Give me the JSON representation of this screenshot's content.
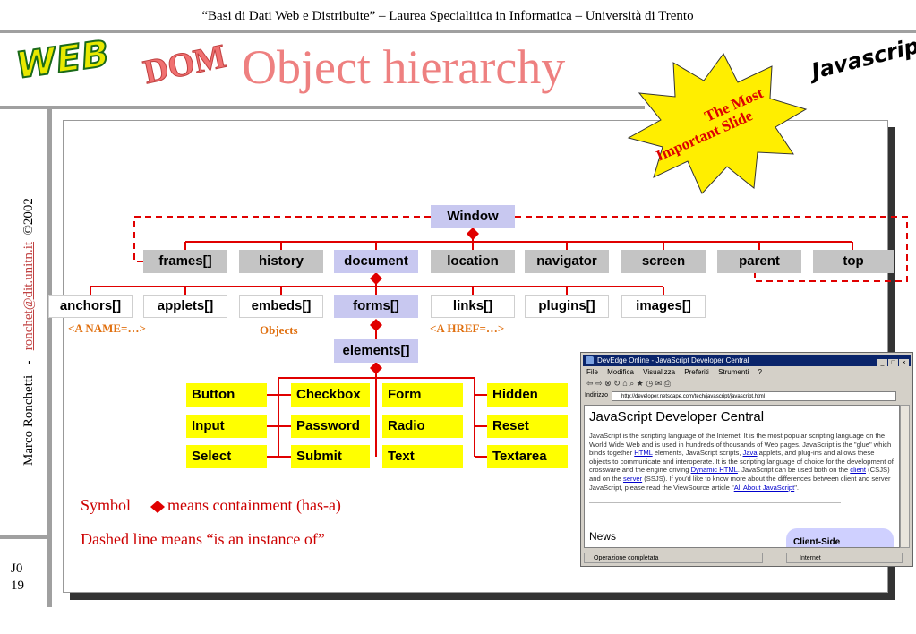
{
  "header": {
    "course_line": "“Basi di Dati Web e Distribuite” – Laurea Specialitica in Informatica – Università di Trento"
  },
  "title": {
    "web": "WEB",
    "dom": "DOM",
    "main": "Object hierarchy",
    "javascript": "Javascript",
    "starburst": [
      "The Most",
      "Important Slide"
    ]
  },
  "sidebar": {
    "author": "Marco Ronchetti",
    "separator": "-",
    "email": "ronchet@dit.unitn.it",
    "copyright": "©2002"
  },
  "slide_id": [
    "J0",
    "19"
  ],
  "hierarchy": {
    "root": "Window",
    "level1": [
      "frames[]",
      "history",
      "document",
      "location",
      "navigator",
      "screen",
      "parent",
      "top"
    ],
    "level2": [
      "anchors[]",
      "applets[]",
      "embeds[]",
      "forms[]",
      "links[]",
      "plugins[]",
      "images[]"
    ],
    "level3": "elements[]",
    "notes": [
      "<A NAME=…>",
      "Objects",
      "<A HREF=…>"
    ],
    "form_elements": [
      [
        "Button",
        "Checkbox",
        "Form",
        "Hidden"
      ],
      [
        "Input",
        "Password",
        "Radio",
        "Reset"
      ],
      [
        "Select",
        "Submit",
        "Text",
        "Textarea"
      ]
    ]
  },
  "legend": {
    "symbol_prefix": "Symbol",
    "symbol_text": "means containment (has-a)",
    "dashed_text": "Dashed line means “is an instance of”"
  },
  "browser": {
    "title": "DevEdge Online - JavaScript Developer Central",
    "menu": [
      "File",
      "Modifica",
      "Visualizza",
      "Preferiti",
      "Strumenti",
      "?"
    ],
    "address_label": "Indirizzo",
    "address_value": "http://developer.netscape.com/tech/javascript/javascript.html",
    "heading": "JavaScript Developer Central",
    "body_1": "JavaScript is the scripting language of the Internet. It is the most popular scripting language on the World Wide Web and is used in hundreds of thousands of Web pages. JavaScript is the \"glue\" which binds together ",
    "link_html": "HTML",
    "body_2": " elements, JavaScript scripts, ",
    "link_java": "Java",
    "body_3": " applets, and plug-ins and allows these objects to communicate and interoperate. It is the scripting language of choice for the development of crossware and the engine driving ",
    "link_dhtml": "Dynamic HTML",
    "body_4": ". JavaScript can be used both on the ",
    "link_client": "client",
    "body_5": " (CSJS) and on the ",
    "link_server": "server",
    "body_6": " (SSJS). If you'd like to know more about the differences between client and server JavaScript, please read the ViewSource article \"",
    "link_article": "All About JavaScript",
    "body_7": "\".",
    "news": "News",
    "client_side": "Client-Side",
    "status_left": "Operazione completata",
    "status_right": "Internet"
  },
  "colors": {
    "line": "#e00000",
    "title": "#ee8080",
    "note": "#e07010",
    "grey_node": "#c4c4c4",
    "blue_node": "#c8c8f0",
    "yellow_node": "#ffff00",
    "star": "#ffee00"
  }
}
